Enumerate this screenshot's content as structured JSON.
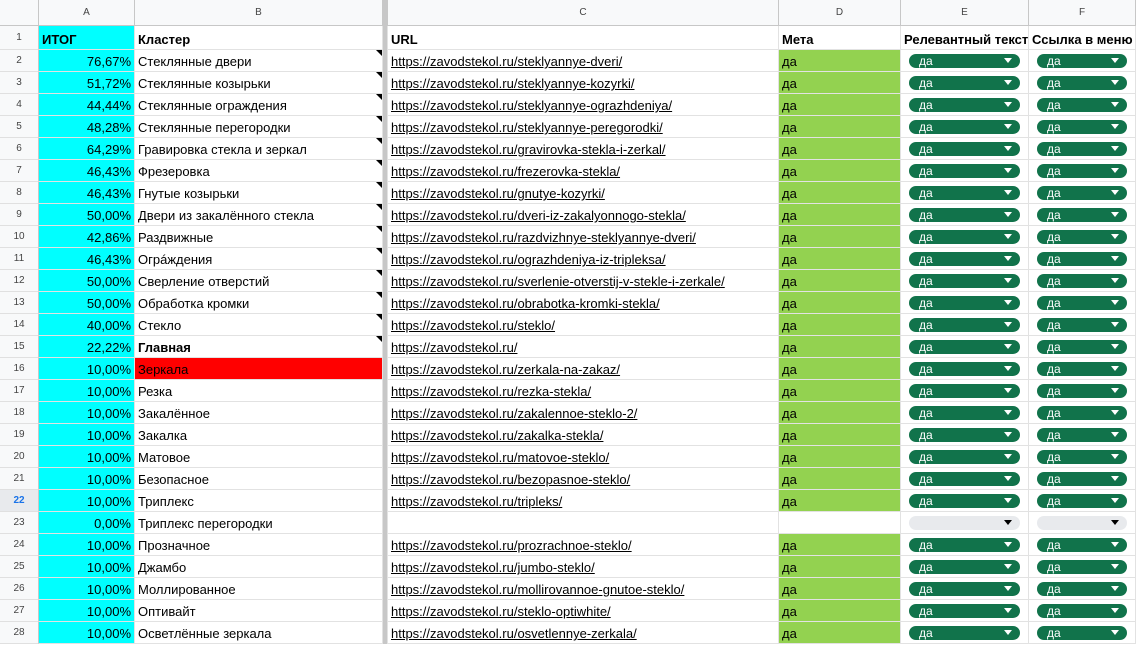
{
  "columns": [
    "A",
    "B",
    "C",
    "D",
    "E",
    "F"
  ],
  "headers": {
    "a": "ИТОГ",
    "b": "Кластер",
    "c": "URL",
    "d": "Мета",
    "e": "Релевантный текст",
    "f": "Ссылка в меню"
  },
  "colors": {
    "total_bg": "#00ffff",
    "meta_bg": "#93d250",
    "chip_bg": "#11734b",
    "error_bg": "#ff0000"
  },
  "rows": [
    {
      "n": "2",
      "total": "76,67%",
      "cluster": "Стеклянные двери",
      "url": "https://zavodstekol.ru/steklyannye-dveri/",
      "meta": "да",
      "rel": "да",
      "menu": "да"
    },
    {
      "n": "3",
      "total": "51,72%",
      "cluster": "Стеклянные козырьки",
      "url": "https://zavodstekol.ru/steklyannye-kozyrki/",
      "meta": "да",
      "rel": "да",
      "menu": "да"
    },
    {
      "n": "4",
      "total": "44,44%",
      "cluster": "Стеклянные ограждения",
      "url": "https://zavodstekol.ru/steklyannye-ograzhdeniya/",
      "meta": "да",
      "rel": "да",
      "menu": "да"
    },
    {
      "n": "5",
      "total": "48,28%",
      "cluster": "Стеклянные перегородки",
      "url": "https://zavodstekol.ru/steklyannye-peregorodki/",
      "meta": "да",
      "rel": "да",
      "menu": "да"
    },
    {
      "n": "6",
      "total": "64,29%",
      "cluster": "Гравировка стекла и зеркал",
      "url": "https://zavodstekol.ru/gravirovka-stekla-i-zerkal/",
      "meta": "да",
      "rel": "да",
      "menu": "да"
    },
    {
      "n": "7",
      "total": "46,43%",
      "cluster": "Фрезеровка",
      "url": "https://zavodstekol.ru/frezerovka-stekla/",
      "meta": "да",
      "rel": "да",
      "menu": "да"
    },
    {
      "n": "8",
      "total": "46,43%",
      "cluster": "Гнутые козырьки",
      "url": "https://zavodstekol.ru/gnutye-kozyrki/",
      "meta": "да",
      "rel": "да",
      "menu": "да"
    },
    {
      "n": "9",
      "total": "50,00%",
      "cluster": "Двери из закалённого стекла",
      "url": "https://zavodstekol.ru/dveri-iz-zakalyonnogo-stekla/",
      "meta": "да",
      "rel": "да",
      "menu": "да"
    },
    {
      "n": "10",
      "total": "42,86%",
      "cluster": "Раздвижные",
      "url": "https://zavodstekol.ru/razdvizhnye-steklyannye-dveri/",
      "meta": "да",
      "rel": "да",
      "menu": "да"
    },
    {
      "n": "11",
      "total": "46,43%",
      "cluster": "Огрáждения",
      "url": "https://zavodstekol.ru/ograzhdeniya-iz-tripleksa/",
      "meta": "да",
      "rel": "да",
      "menu": "да"
    },
    {
      "n": "12",
      "total": "50,00%",
      "cluster": "Сверление отверстий",
      "url": "https://zavodstekol.ru/sverlenie-otverstij-v-stekle-i-zerkale/",
      "meta": "да",
      "rel": "да",
      "menu": "да"
    },
    {
      "n": "13",
      "total": "50,00%",
      "cluster": "Обработка кромки",
      "url": "https://zavodstekol.ru/obrabotka-kromki-stekla/",
      "meta": "да",
      "rel": "да",
      "menu": "да"
    },
    {
      "n": "14",
      "total": "40,00%",
      "cluster": "Стекло",
      "url": "https://zavodstekol.ru/steklo/",
      "meta": "да",
      "rel": "да",
      "menu": "да"
    },
    {
      "n": "15",
      "total": "22,22%",
      "cluster": "Главная",
      "url": "https://zavodstekol.ru/",
      "meta": "да",
      "rel": "да",
      "menu": "да"
    },
    {
      "n": "16",
      "total": "10,00%",
      "cluster": "Зеркала",
      "url": "https://zavodstekol.ru/zerkala-na-zakaz/",
      "meta": "да",
      "rel": "да",
      "menu": "да"
    },
    {
      "n": "17",
      "total": "10,00%",
      "cluster": "Резка",
      "url": "https://zavodstekol.ru/rezka-stekla/",
      "meta": "да",
      "rel": "да",
      "menu": "да"
    },
    {
      "n": "18",
      "total": "10,00%",
      "cluster": "Закалённое",
      "url": "https://zavodstekol.ru/zakalennoe-steklo-2/",
      "meta": "да",
      "rel": "да",
      "menu": "да"
    },
    {
      "n": "19",
      "total": "10,00%",
      "cluster": "Закалка",
      "url": "https://zavodstekol.ru/zakalka-stekla/",
      "meta": "да",
      "rel": "да",
      "menu": "да"
    },
    {
      "n": "20",
      "total": "10,00%",
      "cluster": "Матовое",
      "url": "https://zavodstekol.ru/matovoe-steklo/",
      "meta": "да",
      "rel": "да",
      "menu": "да"
    },
    {
      "n": "21",
      "total": "10,00%",
      "cluster": "Безопасное",
      "url": "https://zavodstekol.ru/bezopasnoe-steklo/",
      "meta": "да",
      "rel": "да",
      "menu": "да"
    },
    {
      "n": "22",
      "total": "10,00%",
      "cluster": "Триплекс",
      "url": "https://zavodstekol.ru/tripleks/",
      "meta": "да",
      "rel": "да",
      "menu": "да"
    },
    {
      "n": "23",
      "total": "0,00%",
      "cluster": "Триплекс перегородки",
      "url": "",
      "meta": "",
      "rel": "",
      "menu": ""
    },
    {
      "n": "24",
      "total": "10,00%",
      "cluster": "Прозначное",
      "url": "https://zavodstekol.ru/prozrachnoe-steklo/",
      "meta": "да",
      "rel": "да",
      "menu": "да"
    },
    {
      "n": "25",
      "total": "10,00%",
      "cluster": "Джамбо",
      "url": "https://zavodstekol.ru/jumbo-steklo/",
      "meta": "да",
      "rel": "да",
      "menu": "да"
    },
    {
      "n": "26",
      "total": "10,00%",
      "cluster": "Моллированное",
      "url": "https://zavodstekol.ru/mollirovannoe-gnutoe-steklo/",
      "meta": "да",
      "rel": "да",
      "menu": "да"
    },
    {
      "n": "27",
      "total": "10,00%",
      "cluster": "Оптивайт",
      "url": "https://zavodstekol.ru/steklo-optiwhite/",
      "meta": "да",
      "rel": "да",
      "menu": "да"
    },
    {
      "n": "28",
      "total": "10,00%",
      "cluster": "Осветлённые зеркала",
      "url": "https://zavodstekol.ru/osvetlennye-zerkala/",
      "meta": "да",
      "rel": "да",
      "menu": "да"
    }
  ]
}
